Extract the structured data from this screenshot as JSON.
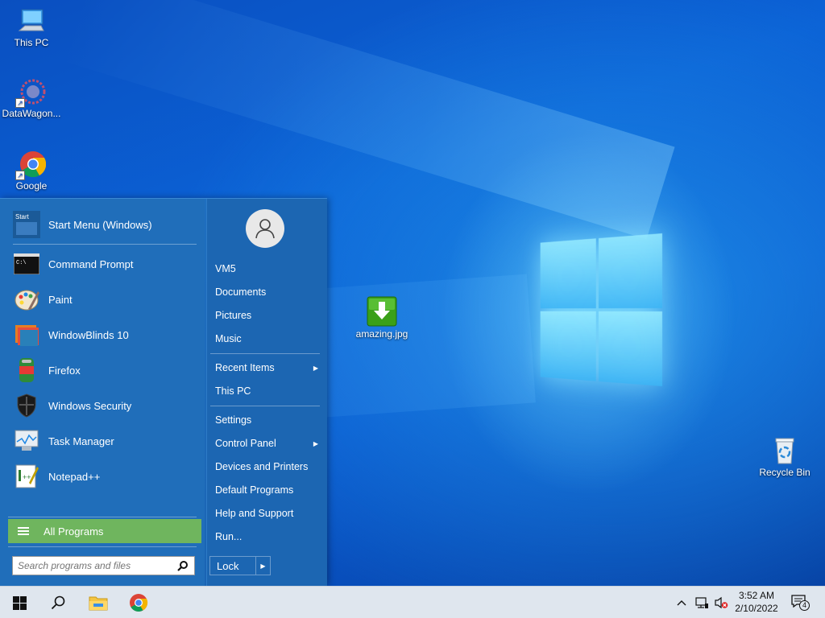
{
  "desktop": {
    "icons": [
      {
        "label": "This PC"
      },
      {
        "label": "DataWagon..."
      },
      {
        "label": "Google"
      },
      {
        "label": "amazing.jpg"
      },
      {
        "label": "Recycle Bin"
      }
    ]
  },
  "start_menu": {
    "pinned": [
      {
        "label": "Start Menu (Windows)",
        "icon": "start-menu-icon"
      },
      {
        "label": "Command Prompt",
        "icon": "command-prompt-icon"
      },
      {
        "label": "Paint",
        "icon": "paint-icon"
      },
      {
        "label": "WindowBlinds 10",
        "icon": "windowblinds-icon"
      },
      {
        "label": "Firefox",
        "icon": "firefox-icon"
      },
      {
        "label": "Windows Security",
        "icon": "shield-icon"
      },
      {
        "label": "Task Manager",
        "icon": "task-manager-icon"
      },
      {
        "label": "Notepad++",
        "icon": "notepadpp-icon"
      }
    ],
    "start_icon_text": "Start",
    "cmd_icon_text": "C:\\",
    "all_programs_label": "All Programs",
    "search_placeholder": "Search programs and files",
    "right_items": [
      {
        "label": "VM5"
      },
      {
        "label": "Documents"
      },
      {
        "label": "Pictures"
      },
      {
        "label": "Music"
      },
      {
        "label": "Recent Items"
      },
      {
        "label": "This PC"
      },
      {
        "label": "Settings"
      },
      {
        "label": "Control Panel"
      },
      {
        "label": "Devices and Printers"
      },
      {
        "label": "Default Programs"
      },
      {
        "label": "Help and Support"
      },
      {
        "label": "Run..."
      }
    ],
    "lock_label": "Lock"
  },
  "taskbar": {
    "time": "3:52 AM",
    "date": "2/10/2022",
    "notification_count": "4"
  },
  "colors": {
    "start_menu_bg": "#206eba",
    "all_programs_bg": "#6fb55e",
    "taskbar_bg": "#dfe6ee"
  }
}
